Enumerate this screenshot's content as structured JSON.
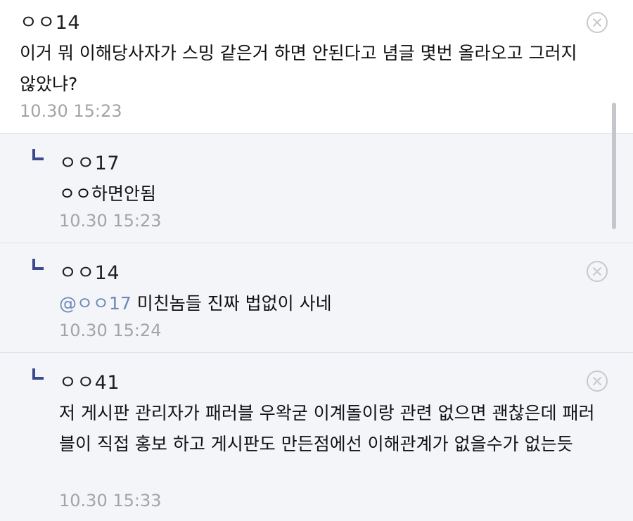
{
  "comments": [
    {
      "author": "ㅇㅇ14",
      "text": "이거 뭐 이해당사자가 스밍 같은거 하면 안된다고 념글 몇번 올라오고 그러지 않았냐?",
      "time": "10.30 15:23"
    }
  ],
  "replies": [
    {
      "author": "ㅇㅇ17",
      "text": "ㅇㅇ하면안됨",
      "time": "10.30 15:23"
    },
    {
      "author": "ㅇㅇ14",
      "mention": "@ㅇㅇ17",
      "text": " 미친놈들 진짜 법없이 사네",
      "time": "10.30 15:24"
    },
    {
      "author": "ㅇㅇ41",
      "text": "저 게시판 관리자가 패러블 우왁굳 이계돌이랑 관련 없으면 괜찮은데 패러블이 직접 홍보 하고 게시판도 만든점에선 이해관계가 없을수가 없는듯",
      "time": "10.30 15:33"
    }
  ],
  "colors": {
    "reply_bg": "#f4f5f9",
    "mention": "#6c89b8",
    "timestamp": "#a3a3a8",
    "reply_icon": "#3a4a8c"
  },
  "icons": {
    "close": "close-circle-icon",
    "reply": "reply-arrow-icon"
  }
}
